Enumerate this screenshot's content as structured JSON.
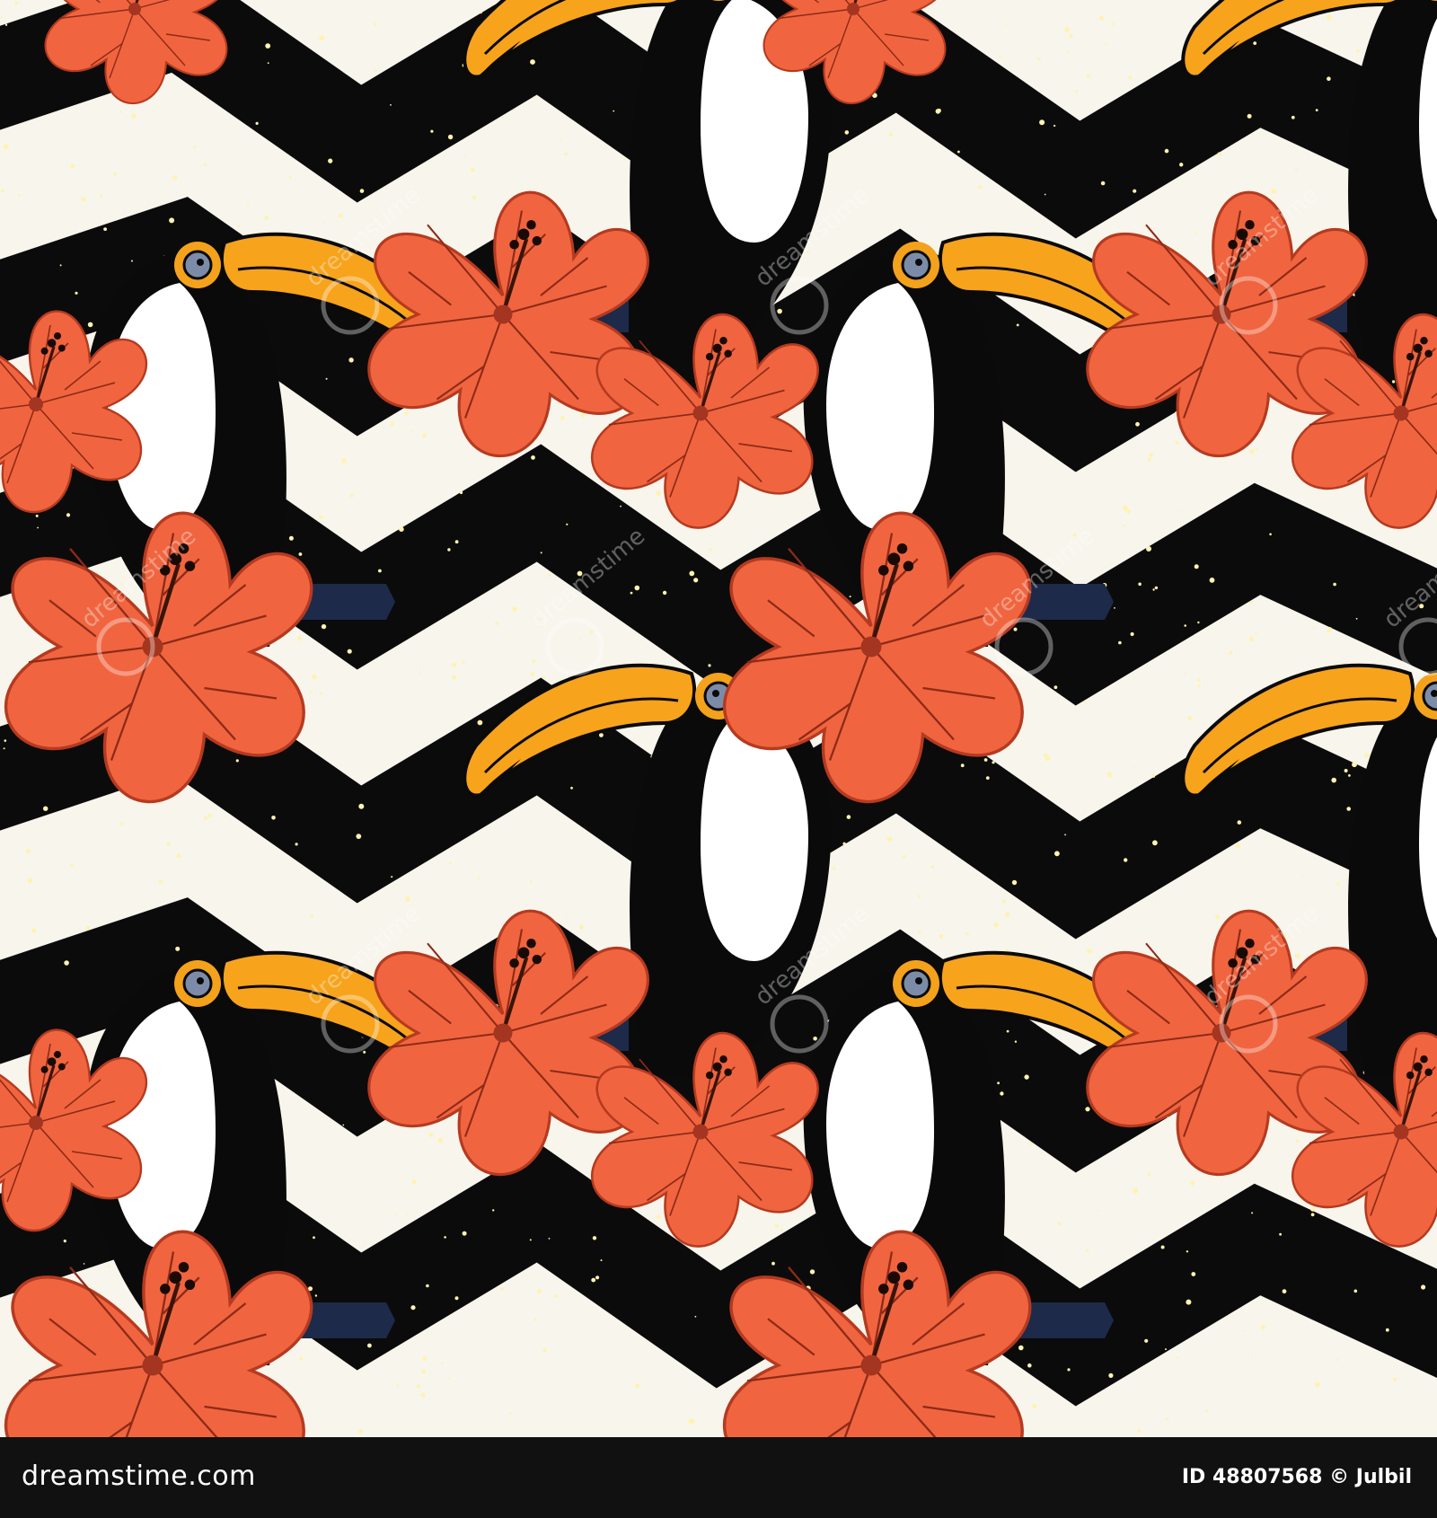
{
  "image": {
    "subject": "seamless pattern",
    "palette": {
      "stripe_black": "#0b0b0b",
      "stripe_white": "#f7f5ec",
      "speckle": "#fff3b0",
      "beak": "#f7a31c",
      "hibiscus": "#f0653f",
      "hibiscus_line": "#8e2a18",
      "toucan_body": "#0a0a0a",
      "toucan_chest": "#ffffff",
      "eye_ring": "#f4a21c",
      "eye": "#7c8ca8",
      "branch": "#1d2a4a"
    }
  },
  "watermark": {
    "text": "dreamstime"
  },
  "footer": {
    "brand": "dreamstime.com",
    "id_text": "ID 48807568",
    "separator": "©",
    "author": "Julbil"
  }
}
